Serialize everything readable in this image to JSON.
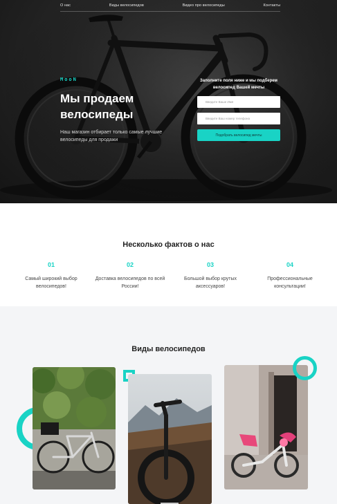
{
  "nav": {
    "items": [
      "О нас",
      "Виды велосипедов",
      "Видео про велосипеды",
      "Контакты"
    ]
  },
  "hero": {
    "logo": "MooN",
    "title": "Мы продаем велосипеды",
    "subtitle": "Наш магазин отбирает только самые лучшие велосипеды для продажи"
  },
  "form": {
    "title": "Заполните поля ниже и мы подберем велосипед Вашей мечты",
    "name_placeholder": "Введите Ваше Имя",
    "phone_placeholder": "Введите Ваш номер телефона",
    "submit_label": "Подобрать велосипед мечты"
  },
  "facts": {
    "title": "Несколько фактов о нас",
    "items": [
      {
        "num": "01",
        "text": "Самый широкий выбор велосипедов!"
      },
      {
        "num": "02",
        "text": "Доставка велосипедов по всей России!"
      },
      {
        "num": "03",
        "text": "Большой выбор крутых аксессуаров!"
      },
      {
        "num": "04",
        "text": "Профессиональные консультации!"
      }
    ]
  },
  "types": {
    "title": "Виды велосипедов"
  },
  "colors": {
    "accent": "#19d3c5",
    "hero_bg": "#1e1e1e",
    "facts_bg": "#ffffff",
    "types_bg": "#f4f5f7"
  }
}
